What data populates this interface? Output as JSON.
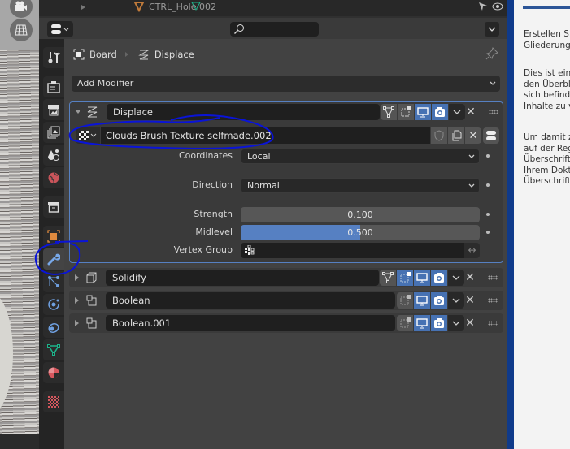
{
  "outliner": {
    "row_label": "CTRL_Hole.002"
  },
  "header": {
    "search_placeholder": ""
  },
  "breadcrumb": {
    "object": "Board",
    "modifier": "Displace"
  },
  "add_modifier_label": "Add Modifier",
  "tabs": [
    {
      "name": "tool",
      "active": false
    },
    {
      "name": "render",
      "active": false
    },
    {
      "name": "output",
      "active": false
    },
    {
      "name": "view-layer",
      "active": false
    },
    {
      "name": "scene",
      "active": false
    },
    {
      "name": "world",
      "active": false
    },
    {
      "name": "collection",
      "active": false
    },
    {
      "name": "object",
      "active": false
    },
    {
      "name": "modifiers",
      "active": true
    },
    {
      "name": "particles",
      "active": false
    },
    {
      "name": "physics",
      "active": false
    },
    {
      "name": "constraints",
      "active": false
    },
    {
      "name": "data",
      "active": false
    },
    {
      "name": "material",
      "active": false
    },
    {
      "name": "texture",
      "active": false
    }
  ],
  "modifiers": [
    {
      "name": "Displace",
      "expanded": true,
      "texture": "Clouds Brush Texture selfmade.002",
      "properties": {
        "coordinates_label": "Coordinates",
        "coordinates_value": "Local",
        "direction_label": "Direction",
        "direction_value": "Normal",
        "strength_label": "Strength",
        "strength_value": "0.100",
        "midlevel_label": "Midlevel",
        "midlevel_value": "0.500",
        "midlevel_fraction": 0.5,
        "vertex_group_label": "Vertex Group",
        "vertex_group_value": ""
      }
    },
    {
      "name": "Solidify",
      "expanded": false
    },
    {
      "name": "Boolean",
      "expanded": false
    },
    {
      "name": "Boolean.001",
      "expanded": false
    }
  ],
  "doc_panel": {
    "para1": [
      "Erstellen Si",
      "Gliederung"
    ],
    "para2": [
      "Dies ist ein",
      "den Überbl",
      "sich befind",
      "Inhalte zu v"
    ],
    "para3": [
      "Um damit z",
      "auf der Reg",
      "Überschrift",
      "Ihrem Dokt",
      "Überschrift"
    ]
  },
  "colors": {
    "accent": "#4772b3",
    "panel_border": "#5680c2",
    "annotation": "#0a14d8"
  }
}
